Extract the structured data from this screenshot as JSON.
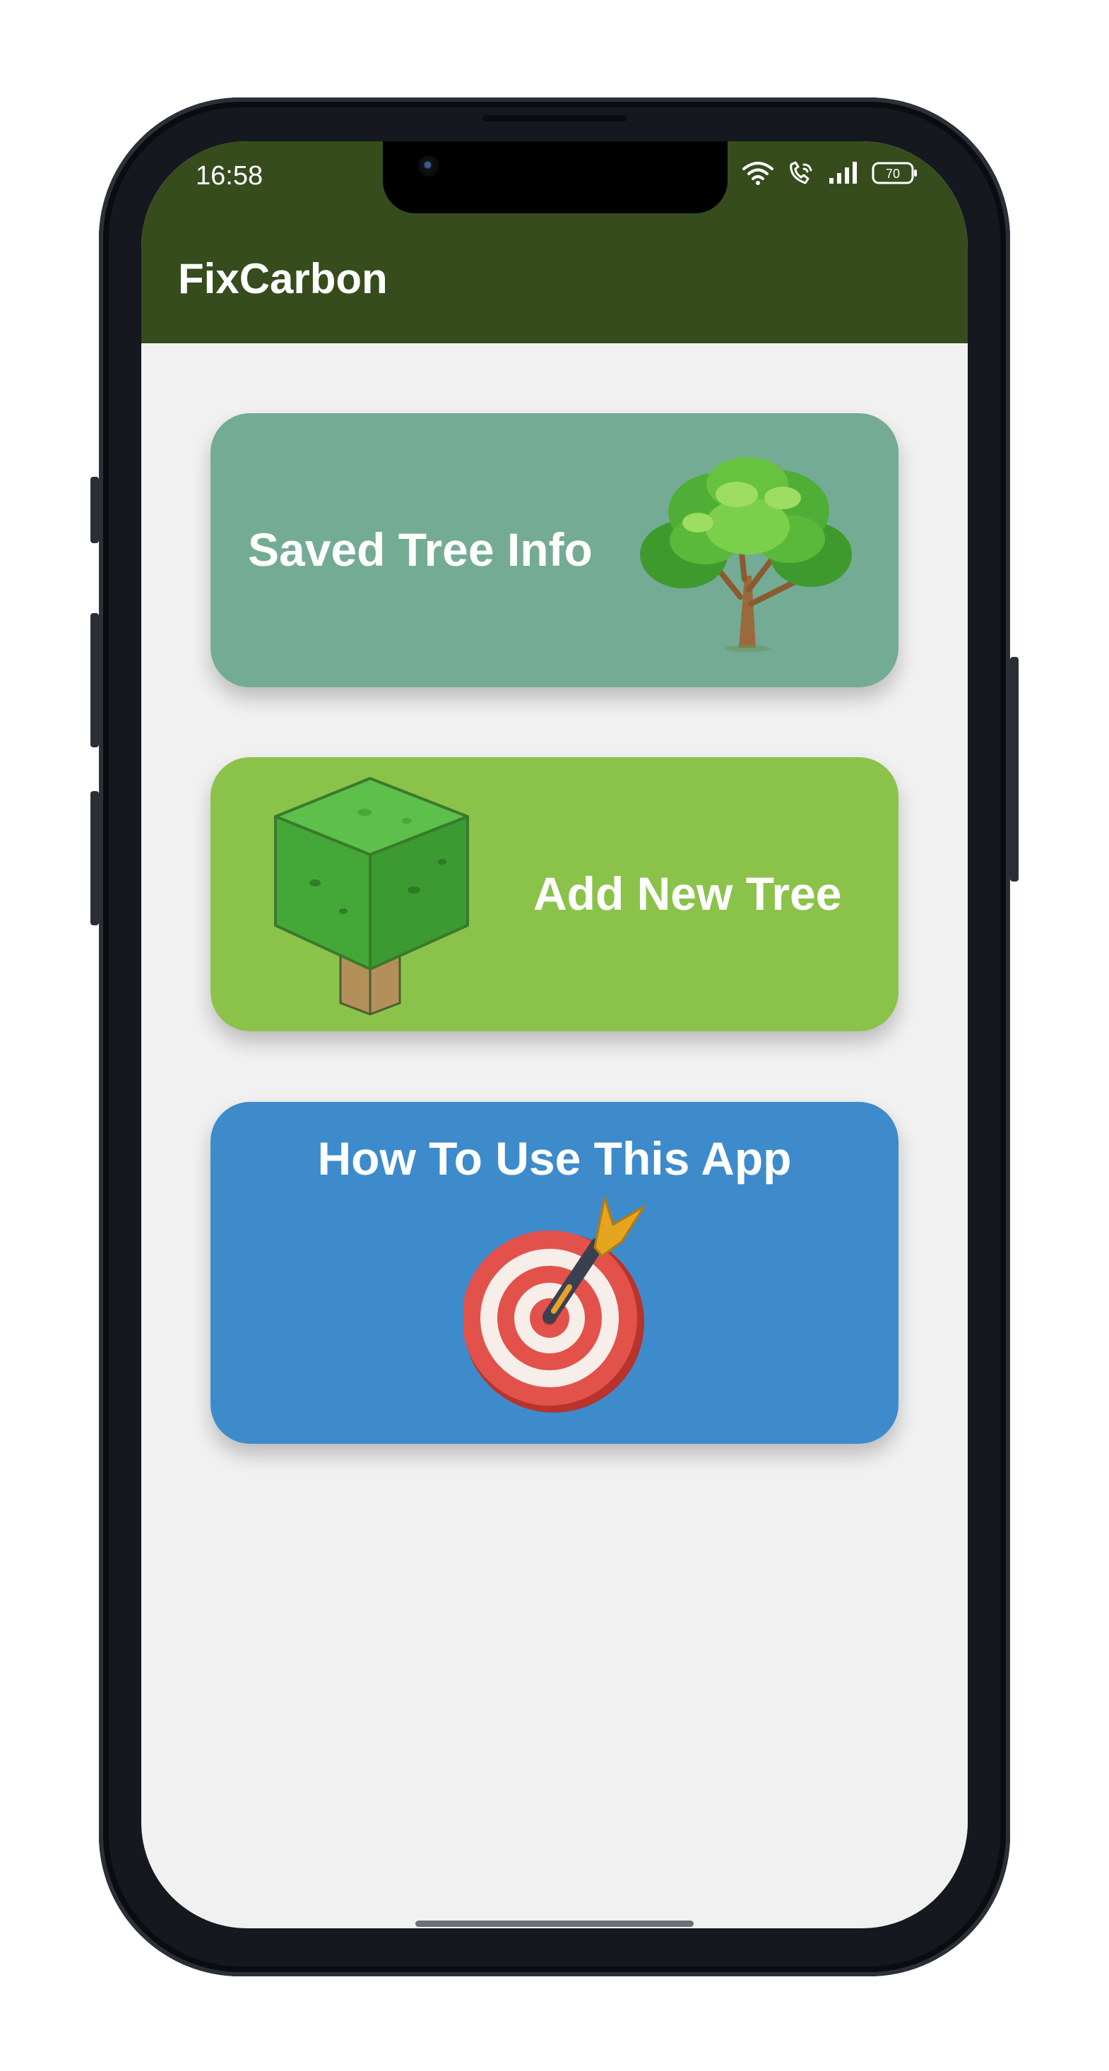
{
  "status_bar": {
    "time": "16:58",
    "battery": "70",
    "icons": [
      "data-speed-icon",
      "wifi-icon",
      "wifi-calling-icon",
      "signal-icon",
      "battery-icon"
    ]
  },
  "app_bar": {
    "title": "FixCarbon",
    "color": "#374c1d"
  },
  "cards": [
    {
      "label": "Saved Tree Info",
      "icon": "tree-icon",
      "color": "#74ab94"
    },
    {
      "label": "Add New Tree",
      "icon": "cube-tree-icon",
      "color": "#8bc34a"
    },
    {
      "label": "How To Use This App",
      "icon": "target-dart-icon",
      "color": "#3d8bcb"
    }
  ]
}
